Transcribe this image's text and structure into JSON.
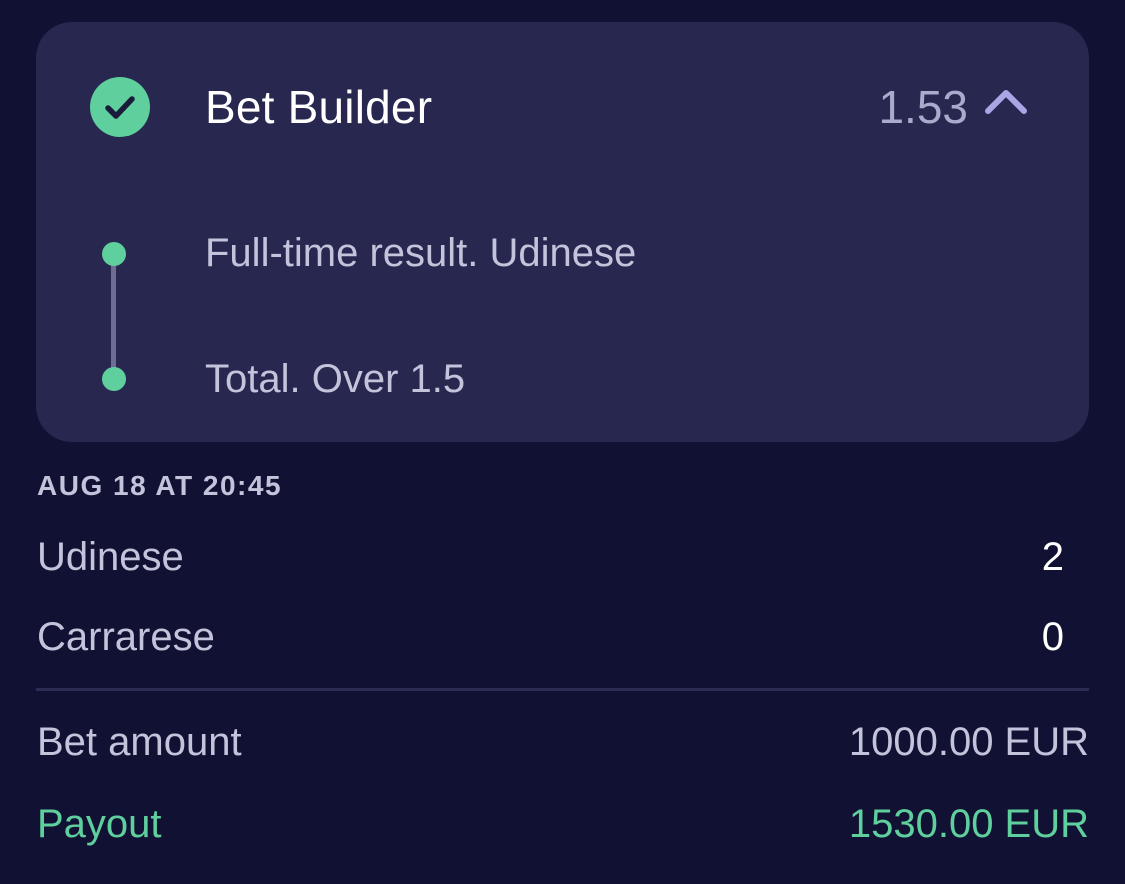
{
  "bet": {
    "title": "Bet Builder",
    "odds": "1.53",
    "status_icon": "check-circle-icon",
    "toggle_icon": "chevron-up-icon",
    "selections": [
      "Full-time result. Udinese",
      "Total. Over 1.5"
    ]
  },
  "event": {
    "date": "AUG 18 AT 20:45",
    "teams": [
      {
        "name": "Udinese",
        "score": "2"
      },
      {
        "name": "Carrarese",
        "score": "0"
      }
    ]
  },
  "summary": {
    "bet_amount_label": "Bet amount",
    "bet_amount_value": "1000.00 EUR",
    "payout_label": "Payout",
    "payout_value": "1530.00 EUR"
  },
  "colors": {
    "background": "#111233",
    "card": "#27274f",
    "accent_green": "#5fcf9d",
    "chevron": "#a9a6e6"
  }
}
